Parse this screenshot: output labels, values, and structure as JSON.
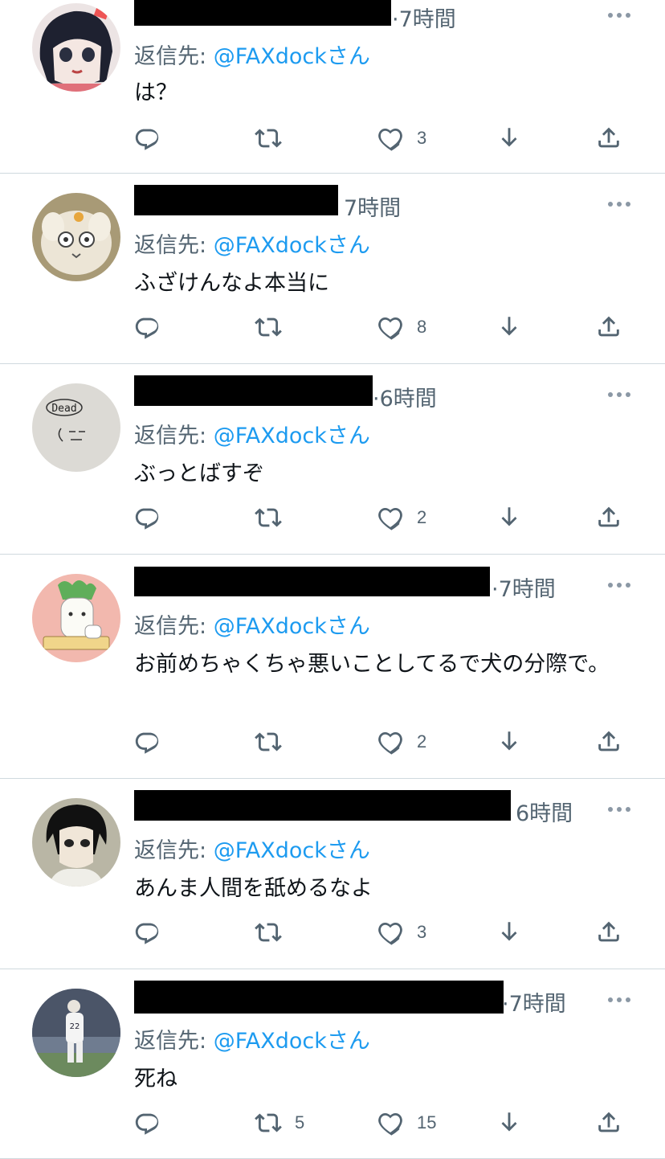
{
  "reply_prefix": "返信先: ",
  "tweets": [
    {
      "time": "7時間",
      "handle": "@FAXdockさん",
      "text": "は？",
      "retweets": "",
      "likes": "3",
      "avatar": "anime-girl"
    },
    {
      "time": "7時間",
      "handle": "@FAXdockさん",
      "text": "ふざけんなよ本当に",
      "retweets": "",
      "likes": "8",
      "avatar": "fluffy-creature"
    },
    {
      "time": "6時間",
      "handle": "@FAXdockさん",
      "text": "ぶっとばすぞ",
      "retweets": "",
      "likes": "2",
      "avatar": "dead-doodle",
      "avatar_text": "Dead"
    },
    {
      "time": "7時間",
      "handle": "@FAXdockさん",
      "text": "お前めちゃくちゃ悪いことしてるで犬の分際で。",
      "retweets": "",
      "likes": "2",
      "avatar": "radish-character"
    },
    {
      "time": "6時間",
      "handle": "@FAXdockさん",
      "text": "あんま人間を舐めるなよ",
      "retweets": "",
      "likes": "3",
      "avatar": "anime-man"
    },
    {
      "time": "7時間",
      "handle": "@FAXdockさん",
      "text": "死ね",
      "retweets": "5",
      "likes": "15",
      "avatar": "baseball-player",
      "avatar_text": "22"
    }
  ],
  "colors": {
    "accent": "#1d9bf0",
    "secondary": "#536471",
    "divider": "#cfd9de"
  }
}
